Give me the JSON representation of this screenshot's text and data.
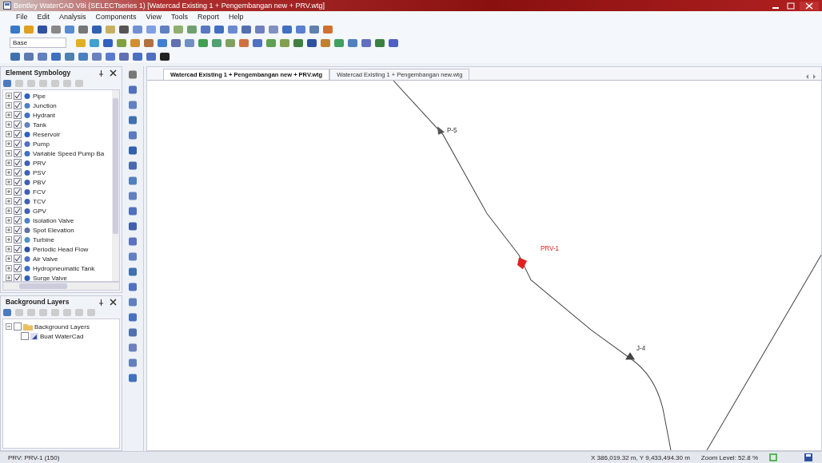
{
  "window": {
    "title": "Bentley WaterCAD V8i (SELECTseries 1) [Watercad Existing 1 + Pengembangan new + PRV.wtg]"
  },
  "menu": [
    "File",
    "Edit",
    "Analysis",
    "Components",
    "View",
    "Tools",
    "Report",
    "Help"
  ],
  "zoom_field": {
    "value": "Base"
  },
  "element_symbology": {
    "title": "Element Symbology",
    "items": [
      {
        "label": "Pipe",
        "checked": true
      },
      {
        "label": "Junction",
        "checked": true
      },
      {
        "label": "Hydrant",
        "checked": true
      },
      {
        "label": "Tank",
        "checked": true
      },
      {
        "label": "Reservoir",
        "checked": true
      },
      {
        "label": "Pump",
        "checked": true
      },
      {
        "label": "Variable Speed Pump Ba",
        "checked": true
      },
      {
        "label": "PRV",
        "checked": true
      },
      {
        "label": "PSV",
        "checked": true
      },
      {
        "label": "PBV",
        "checked": true
      },
      {
        "label": "FCV",
        "checked": true
      },
      {
        "label": "TCV",
        "checked": true
      },
      {
        "label": "GPV",
        "checked": true
      },
      {
        "label": "Isolation Valve",
        "checked": true
      },
      {
        "label": "Spot Elevation",
        "checked": true
      },
      {
        "label": "Turbine",
        "checked": true
      },
      {
        "label": "Periodic Head Flow",
        "checked": true
      },
      {
        "label": "Air Valve",
        "checked": true
      },
      {
        "label": "Hydropneumatic Tank",
        "checked": true
      },
      {
        "label": "Surge Valve",
        "checked": true
      }
    ]
  },
  "background_layers": {
    "title": "Background Layers",
    "items": [
      {
        "label": "Background Layers",
        "checked": false,
        "expanded": true,
        "children": [
          {
            "label": "Buat WaterCad",
            "checked": false
          }
        ]
      }
    ]
  },
  "tabs": [
    {
      "label": "Watercad Existing 1 + Pengembangan new + PRV.wtg",
      "selected": true
    },
    {
      "label": "Watercad Existing 1 + Pengembangan new.wtg",
      "selected": false
    }
  ],
  "canvas": {
    "labels": [
      {
        "text": "P-5",
        "kind": "pipe"
      },
      {
        "text": "PRV-1",
        "kind": "valve"
      },
      {
        "text": "J-4",
        "kind": "junction"
      }
    ]
  },
  "status_bar": {
    "selection": "PRV: PRV-1 (150)",
    "coordinates": "X 386,019.32 m, Y 9,433,494.30 m",
    "zoom": "Zoom Level: 52.8 %"
  }
}
